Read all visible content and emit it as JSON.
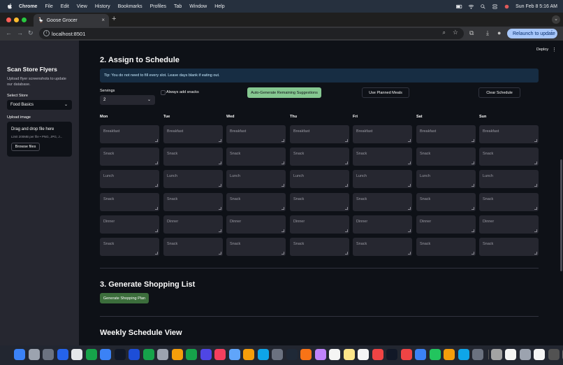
{
  "menubar": {
    "app": "Chrome",
    "items": [
      "File",
      "Edit",
      "View",
      "History",
      "Bookmarks",
      "Profiles",
      "Tab",
      "Window",
      "Help"
    ],
    "clock": "Sun Feb 8  5:16 AM"
  },
  "browser": {
    "tab_title": "Goose Grocer",
    "url": "localhost:8501",
    "relaunch_label": "Relaunch to update"
  },
  "sidebar": {
    "title": "Scan Store Flyers",
    "description": "Upload flyer screenshots to update our database.",
    "select_label": "Select Store",
    "select_value": "Food Basics",
    "upload_label": "Upload image",
    "dropzone_title": "Drag and drop file here",
    "dropzone_sub": "Limit 200MB per file • PNG, JPG, J...",
    "browse_label": "Browse files"
  },
  "header": {
    "deploy_label": "Deploy"
  },
  "schedule": {
    "title": "2. Assign to Schedule",
    "tip": "Tip: You do not need to fill every slot. Leave days blank if eating out.",
    "servings_label": "Servings",
    "servings_value": "2",
    "snacks_label": "Always add snacks",
    "auto_button": "Auto-Generate Remaining Suggestions",
    "planned_button": "Use Planned Meals",
    "clear_button": "Clear Schedule",
    "days": [
      "Mon",
      "Tue",
      "Wed",
      "Thu",
      "Fri",
      "Sat",
      "Sun"
    ],
    "slots": [
      "Breakfast",
      "Snack",
      "Lunch",
      "Snack",
      "Dinner",
      "Snack"
    ]
  },
  "shopping": {
    "title": "3. Generate Shopping List",
    "button": "Generate Shopping Plan"
  },
  "weekly": {
    "title": "Weekly Schedule View"
  },
  "colors": {
    "app_bg": "#0e1117",
    "sidebar_bg": "#262730",
    "primary_green": "#85c790",
    "tip_bg": "#172d43"
  }
}
